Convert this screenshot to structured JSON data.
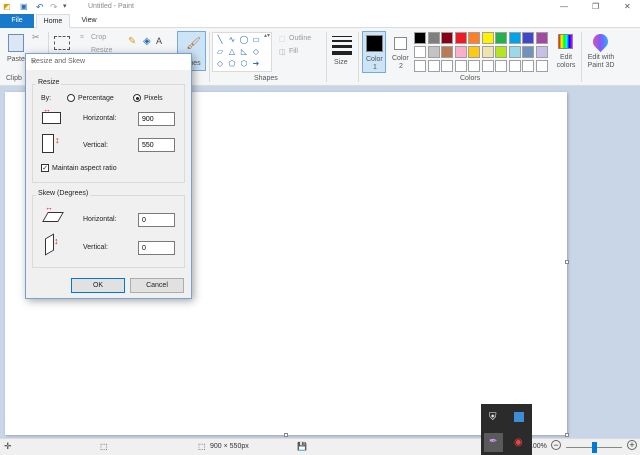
{
  "window": {
    "title": "Untitled - Paint",
    "minimize": "—",
    "maximize": "❐",
    "close": "✕"
  },
  "tabs": [
    {
      "label": "File"
    },
    {
      "label": "Home"
    },
    {
      "label": "View"
    }
  ],
  "ribbon": {
    "clipboard": {
      "paste_label": "Paste",
      "group_label": "Clipb"
    },
    "image": {
      "crop_label": "Crop",
      "resize_label": "Resize"
    },
    "tools_partial_label": "ushes",
    "shapes": {
      "outline_label": "Outline",
      "fill_label": "Fill",
      "group_label": "Shapes"
    },
    "size_label": "Size",
    "color1": {
      "label": "Color",
      "sub": "1",
      "value": "#000000"
    },
    "color2": {
      "label": "Color",
      "sub": "2",
      "value": "#ffffff"
    },
    "colors_group_label": "Colors",
    "edit_colors_label": "Edit colors",
    "paint3d_label": "Edit with Paint 3D",
    "palette_row1": [
      "#000000",
      "#7f7f7f",
      "#880015",
      "#ed1c24",
      "#ff7f27",
      "#fff200",
      "#22b14c",
      "#00a2e8",
      "#3f48cc",
      "#a349a4"
    ],
    "palette_row2": [
      "#ffffff",
      "#c3c3c3",
      "#b97a57",
      "#ffaec9",
      "#ffc90e",
      "#efe4b0",
      "#b5e61d",
      "#99d9ea",
      "#7092be",
      "#c8bfe7"
    ],
    "palette_row3": [
      "#ffffff",
      "#ffffff",
      "#ffffff",
      "#ffffff",
      "#ffffff",
      "#ffffff",
      "#ffffff",
      "#ffffff",
      "#ffffff",
      "#ffffff"
    ]
  },
  "dialog": {
    "title": "Resize and Skew",
    "resize_legend": "Resize",
    "by_label": "By:",
    "percentage_label": "Percentage",
    "pixels_label": "Pixels",
    "selected_mode": "pixels",
    "horizontal_label": "Horizontal:",
    "horizontal_value": "900",
    "vertical_label": "Vertical:",
    "vertical_value": "550",
    "maintain_label": "Maintain aspect ratio",
    "maintain_checked": true,
    "skew_legend": "Skew (Degrees)",
    "skew_horizontal_label": "Horizontal:",
    "skew_horizontal_value": "0",
    "skew_vertical_label": "Vertical:",
    "skew_vertical_value": "0",
    "ok_label": "OK",
    "cancel_label": "Cancel"
  },
  "status": {
    "size_text": "900 × 550px",
    "zoom_text": "100%",
    "zoom_minus": "−",
    "zoom_plus": "+"
  }
}
